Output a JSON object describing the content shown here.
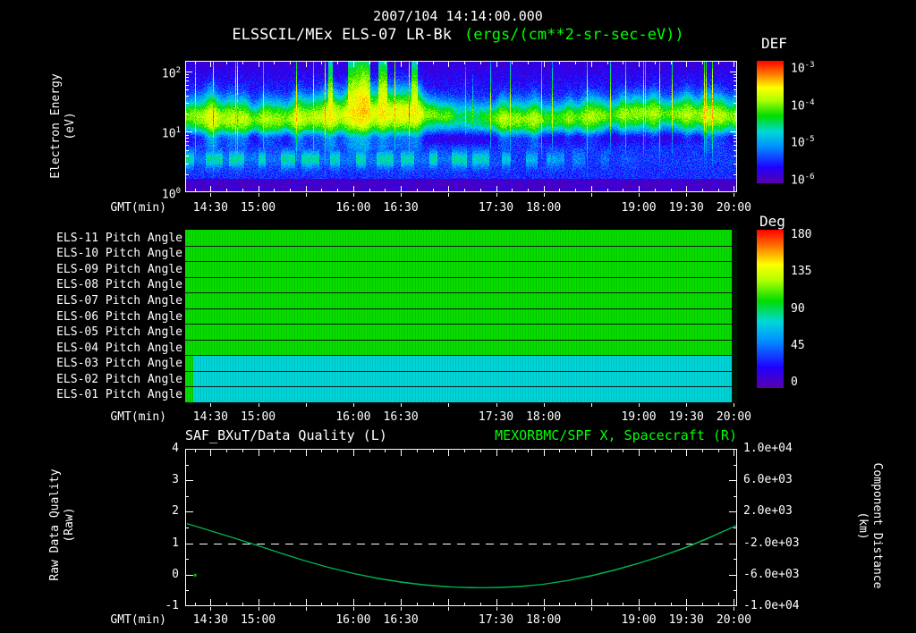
{
  "header": {
    "title": "2007/104 14:14:00.000",
    "subtitle_instrument": "ELSSCIL/MEx ELS-07 LR-Bk",
    "subtitle_units": "(ergs/(cm**2-sr-sec-eV))"
  },
  "time_axis": {
    "label": "GMT(min)",
    "start": "14:14",
    "end": "20:02",
    "tick_labels": [
      "14:30",
      "15:00",
      "16:00",
      "16:30",
      "17:30",
      "18:00",
      "19:00",
      "19:30",
      "20:00"
    ],
    "major_tick_every_min": 30,
    "minor_tick_every_min": 10
  },
  "colors": {
    "background": "#000000",
    "text": "#ffffff",
    "green_text": "#00ff00",
    "rainbow_stops": [
      [
        0,
        "#5a00a8"
      ],
      [
        0.13,
        "#2000ff"
      ],
      [
        0.3,
        "#0090ff"
      ],
      [
        0.42,
        "#00d8d8"
      ],
      [
        0.55,
        "#00dc00"
      ],
      [
        0.68,
        "#b0ff00"
      ],
      [
        0.78,
        "#ffff00"
      ],
      [
        0.9,
        "#ff7000"
      ],
      [
        1,
        "#ff0000"
      ]
    ]
  },
  "chart_data": [
    {
      "id": "electron-energy-spectrogram",
      "type": "heatmap",
      "ylabel_lines": [
        "Electron Energy",
        "(eV)"
      ],
      "xlabel": "GMT(min)",
      "y_scale": "log",
      "ylim_ev": [
        1,
        150
      ],
      "ytick_exponents": [
        2,
        1,
        0
      ],
      "colorbar": {
        "title": "DEF",
        "units": "ergs/(cm**2-sr-sec-eV)",
        "scale": "log",
        "tick_exponents": [
          -3,
          -4,
          -5,
          -6
        ],
        "range_exponents": [
          -6,
          -3
        ]
      },
      "background_log10_flux": -5.45,
      "main_band": {
        "center_ev": 18,
        "sigma_log": 0.16,
        "peak_profile": {
          "t_frac": [
            0,
            0.05,
            0.12,
            0.2,
            0.28,
            0.33,
            0.37,
            0.4,
            0.44,
            0.49,
            0.53,
            0.56,
            0.62,
            0.68,
            0.72,
            0.78,
            0.82,
            0.88,
            0.93,
            1
          ],
          "log10_flux": [
            -4.1,
            -3.9,
            -4.0,
            -3.9,
            -3.85,
            -3.6,
            -3.75,
            -3.55,
            -3.95,
            -4.45,
            -4.6,
            -4.1,
            -3.9,
            -4.2,
            -4.0,
            -4.25,
            -3.95,
            -4.05,
            -3.9,
            -4.05
          ]
        }
      },
      "low_band": {
        "center_ev": 3.5,
        "sigma_log": 0.1,
        "peak_log10_flux": -4.65
      },
      "bursts_gmt": [
        "16:05",
        "16:15",
        "16:40",
        "18:20",
        "19:25"
      ]
    },
    {
      "id": "pitch-angle-rows",
      "type": "heatmap",
      "xlabel": "GMT(min)",
      "colorbar": {
        "title": "Deg",
        "range": [
          0,
          180
        ],
        "ticks": [
          180,
          135,
          90,
          45,
          0
        ]
      },
      "rows": [
        {
          "label": "ELS-11 Pitch Angle",
          "pitch_deg": 100
        },
        {
          "label": "ELS-10 Pitch Angle",
          "pitch_deg": 100
        },
        {
          "label": "ELS-09 Pitch Angle",
          "pitch_deg": 100
        },
        {
          "label": "ELS-08 Pitch Angle",
          "pitch_deg": 100
        },
        {
          "label": "ELS-07 Pitch Angle",
          "pitch_deg": 100
        },
        {
          "label": "ELS-06 Pitch Angle",
          "pitch_deg": 100
        },
        {
          "label": "ELS-05 Pitch Angle",
          "pitch_deg": 100
        },
        {
          "label": "ELS-04 Pitch Angle",
          "pitch_deg": 100
        },
        {
          "label": "ELS-03 Pitch Angle",
          "pitch_deg": 75
        },
        {
          "label": "ELS-02 Pitch Angle",
          "pitch_deg": 75
        },
        {
          "label": "ELS-01 Pitch Angle",
          "pitch_deg": 75
        }
      ]
    },
    {
      "id": "quality-and-distance",
      "type": "line",
      "title_left": "SAF_BXuT/Data Quality (L)",
      "title_right": "MEXORBMC/SPF X, Spacecraft (R)",
      "ylabel_left_lines": [
        "Raw Data Quality",
        "(Raw)"
      ],
      "ylabel_right_lines": [
        "Component Distance",
        "(km)"
      ],
      "xlabel": "GMT(min)",
      "ylim_left": [
        -1,
        4
      ],
      "yticks_left": [
        4,
        3,
        2,
        1,
        0,
        -1
      ],
      "ylim_right": [
        -10000,
        10000
      ],
      "ytick_labels_right": [
        "1.0e+04",
        "6.0e+03",
        "2.0e+03",
        "-2.0e+03",
        "-6.0e+03",
        "-1.0e+04"
      ],
      "series": [
        {
          "name": "SAF_BXuT/Data Quality (L)",
          "axis": "left",
          "style": "dashed",
          "color": "#ffffff",
          "value": 1
        },
        {
          "name": "MEXORBMC/SPF X, Spacecraft (R)",
          "axis": "right",
          "style": "solid",
          "color": "#00b450",
          "t_min": [
            1,
            16,
            46,
            76,
            106,
            136,
            166,
            196,
            226,
            256,
            286,
            316,
            346,
            348
          ],
          "x_km": [
            500,
            -400,
            -2300,
            -4300,
            -5900,
            -7000,
            -7600,
            -7700,
            -7300,
            -6200,
            -4600,
            -2600,
            100,
            300
          ]
        }
      ],
      "marker": {
        "t_min": 6,
        "value_left": 0,
        "color": "#00c000"
      }
    }
  ]
}
